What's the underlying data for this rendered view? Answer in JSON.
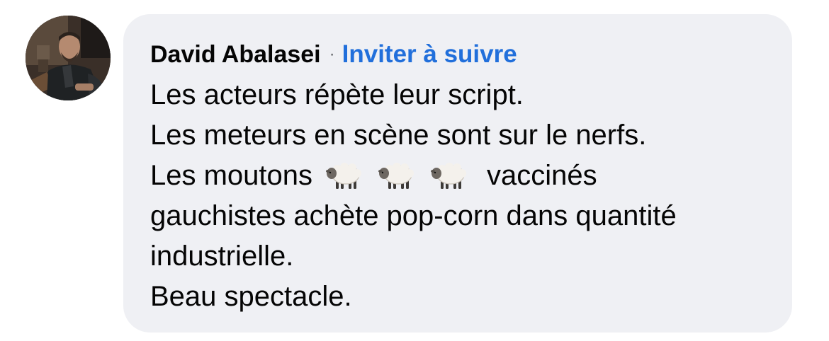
{
  "comment": {
    "author": "David Abalasei",
    "separator": "·",
    "follow_link": "Inviter à suivre",
    "lines": {
      "l1": "Les acteurs répète leur script.",
      "l2": "Les meteurs en scène sont sur le nerfs.",
      "l3_before": "Les moutons",
      "l3_after": "vaccinés",
      "l4": "gauchistes achète pop-corn dans quantité",
      "l5": "industrielle.",
      "l6": "Beau spectacle."
    },
    "emoji": [
      "sheep-icon",
      "sheep-icon",
      "sheep-icon"
    ]
  },
  "colors": {
    "bubble_background": "#eff0f4",
    "link": "#216fdb",
    "text": "#050505",
    "separator": "#65676b"
  }
}
